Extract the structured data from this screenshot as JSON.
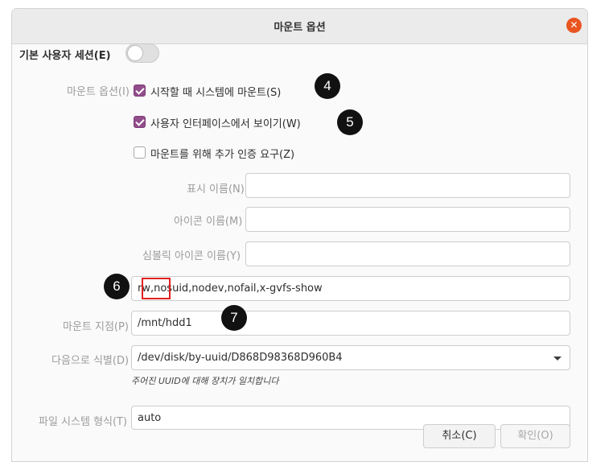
{
  "window": {
    "title": "마운트 옵션",
    "close_icon": "close-icon"
  },
  "session": {
    "label": "기본 사용자 세션(E)",
    "toggle_on": false
  },
  "mount_options": {
    "label": "마운트 옵션(I)",
    "checkboxes": [
      {
        "label": "시작할 때 시스템에 마운트(S)",
        "checked": true
      },
      {
        "label": "사용자 인터페이스에서 보이기(W)",
        "checked": true
      },
      {
        "label": "마운트를 위해 추가 인증 요구(Z)",
        "checked": false
      }
    ]
  },
  "display_name": {
    "label": "표시 이름(N)",
    "value": ""
  },
  "icon_name": {
    "label": "아이콘 이름(M)",
    "value": ""
  },
  "symbolic_icon_name": {
    "label": "심볼릭 아이콘 이름(Y)",
    "value": ""
  },
  "options_field": {
    "value": "rw,nosuid,nodev,nofail,x-gvfs-show"
  },
  "mount_point": {
    "label": "마운트 지점(P)",
    "value": "/mnt/hdd1"
  },
  "identify_as": {
    "label": "다음으로 식별(D)",
    "value": "/dev/disk/by-uuid/D868D98368D960B4",
    "hint": "주어진 UUID에 대해 장치가 일치합니다"
  },
  "filesystem_type": {
    "label": "파일 시스템 형식(T)",
    "value": "auto"
  },
  "buttons": {
    "cancel": "취소(C)",
    "ok": "확인(O)"
  },
  "markers": [
    "4",
    "5",
    "6",
    "7"
  ],
  "colors": {
    "accent": "#924d8b",
    "close": "#e95420",
    "highlight": "#e02020"
  }
}
